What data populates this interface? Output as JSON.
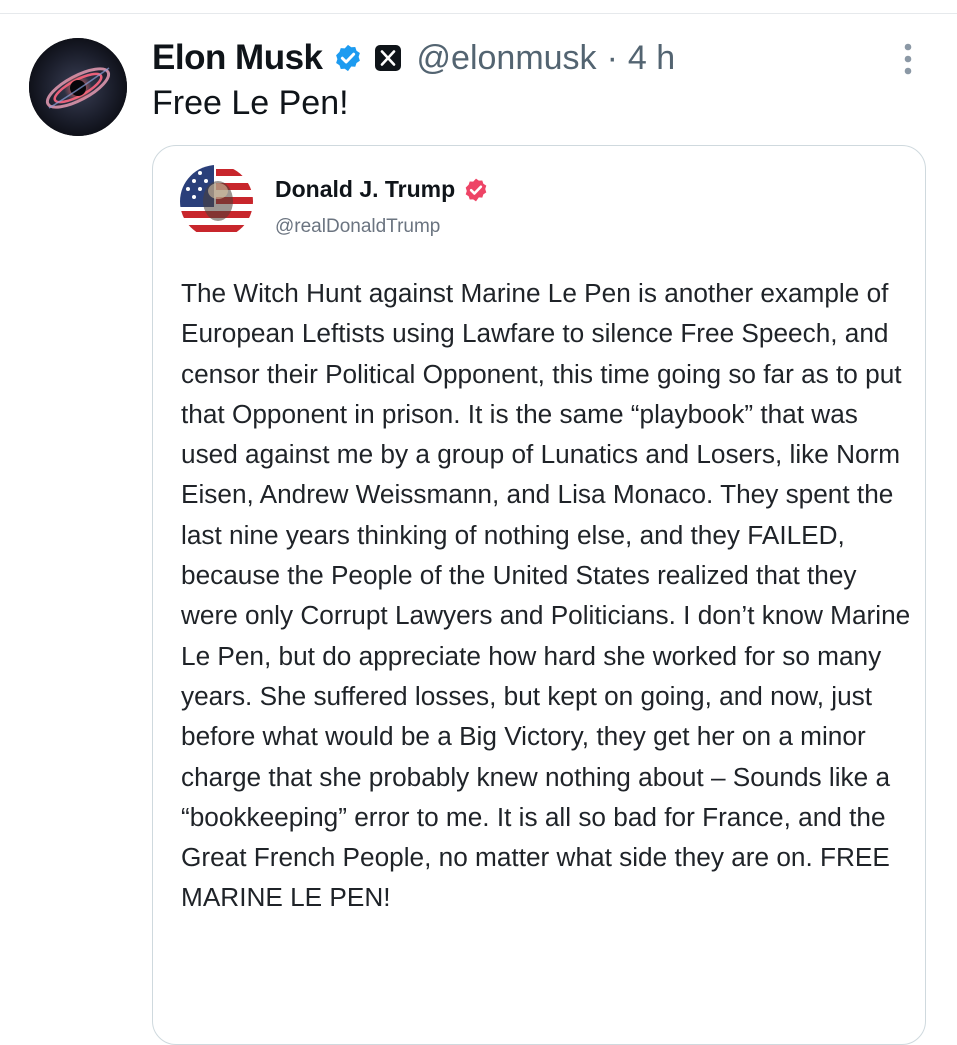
{
  "tweet": {
    "author": {
      "display_name": "Elon Musk",
      "handle": "@elonmusk",
      "verified_color": "#1d9bf0",
      "avatar_icon": "black-hole-avatar"
    },
    "separator": "·",
    "time": "4 h",
    "text": "Free Le Pen!",
    "more_icon": "vertical-ellipsis-icon"
  },
  "quote": {
    "author": {
      "display_name": "Donald J. Trump",
      "handle": "@realDonaldTrump",
      "verified_color": "#ee4466",
      "avatar_icon": "flag-portrait-avatar"
    },
    "body": "The Witch Hunt against Marine Le Pen is another example of European Leftists using Lawfare to silence Free Speech, and censor their Political Opponent, this time going so far as to put that Opponent in prison. It is the same “playbook” that was used against me by a group of Lunatics and Losers, like Norm Eisen, Andrew Weissmann, and Lisa Monaco. They spent the last nine years thinking of nothing else, and they FAILED, because the People of the United States realized that they were only Corrupt Lawyers and Politicians. I don’t know Marine Le Pen, but do appreciate how hard she worked for so many years. She suffered losses, but kept on going, and now, just before what would be a Big Victory, they get her on a minor charge that she probably knew nothing about – Sounds like a “bookkeeping” error to me. It is all so bad for France, and the Great French People, no matter what side they are on. FREE MARINE LE PEN!"
  }
}
